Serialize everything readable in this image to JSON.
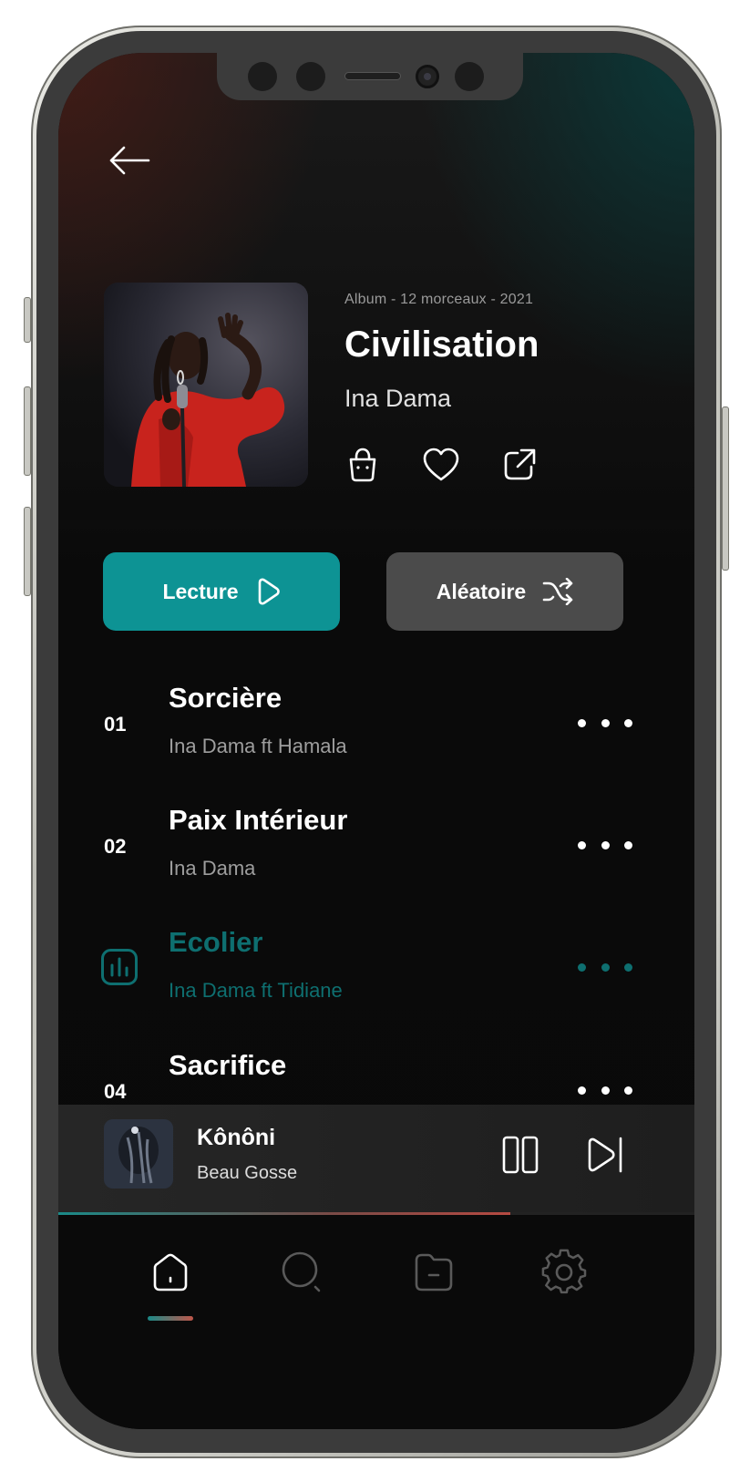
{
  "album": {
    "meta": "Album - 12 morceaux - 2021",
    "title": "Civilisation",
    "artist": "Ina Dama",
    "action_icons": [
      "bag-icon",
      "heart-icon",
      "share-icon"
    ]
  },
  "buttons": {
    "play_label": "Lecture",
    "shuffle_label": "Aléatoire"
  },
  "tracks": [
    {
      "number": "01",
      "title": "Sorcière",
      "artist": "Ina Dama ft Hamala",
      "playing": false
    },
    {
      "number": "02",
      "title": "Paix Intérieur",
      "artist": "Ina Dama",
      "playing": false
    },
    {
      "number": "",
      "title": "Ecolier",
      "artist": "Ina Dama ft Tidiane",
      "playing": true
    },
    {
      "number": "04",
      "title": "Sacrifice",
      "artist": "",
      "playing": false
    }
  ],
  "now_playing": {
    "title": "Kônôni",
    "artist": "Beau Gosse",
    "progress": 0.71
  },
  "nav": {
    "items": [
      "home-icon",
      "search-icon",
      "folder-icon",
      "settings-icon"
    ],
    "active": "home"
  },
  "colors": {
    "accent": "#0d9394",
    "playing": "#0e6f70",
    "secondary_button": "#4b4b4b",
    "background": "#090909"
  }
}
